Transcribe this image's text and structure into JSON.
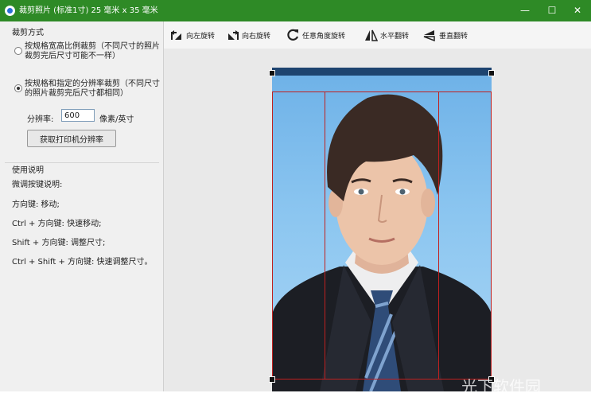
{
  "window": {
    "title": "裁剪照片 (标准1寸) 25 毫米 x 35 毫米",
    "min_glyph": "—",
    "max_glyph": "☐",
    "close_glyph": "✕"
  },
  "left": {
    "crop_mode_title": "裁剪方式",
    "option1": "按规格宽高比例裁剪（不同尺寸的照片裁剪完后尺寸可能不一样）",
    "option2": "按规格和指定的分辨率裁剪（不同尺寸的照片裁剪完后尺寸都相同）",
    "selected_option": 2,
    "resolution_label": "分辨率:",
    "resolution_value": "600",
    "resolution_unit": "像素/英寸",
    "printer_button": "获取打印机分辨率",
    "help_title": "使用说明",
    "help_lines": [
      "微调按键说明:",
      "方向键: 移动;",
      "Ctrl + 方向键: 快速移动;",
      "Shift + 方向键: 调整尺寸;",
      "Ctrl + Shift + 方向键: 快速调整尺寸。"
    ]
  },
  "toolbar": {
    "rotate_left": "向左旋转",
    "rotate_right": "向右旋转",
    "rotate_any": "任意角度旋转",
    "flip_h": "水平翻转",
    "flip_v": "垂直翻转"
  },
  "watermark": "光下软件园",
  "colors": {
    "titlebar": "#2e8a26",
    "crop_lines": "#c0201f",
    "photo_background": "#8cc6f0"
  }
}
